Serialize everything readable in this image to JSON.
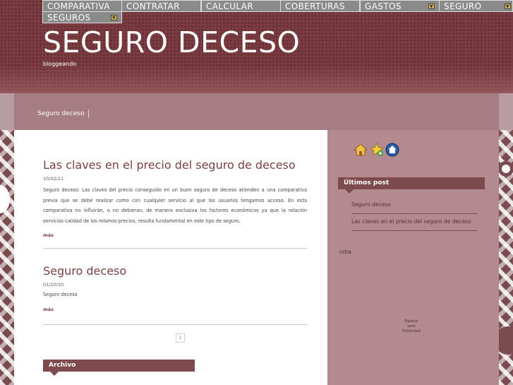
{
  "nav": {
    "items": [
      {
        "label": "COMPARATIVA",
        "dropdown": false
      },
      {
        "label": "CONTRATAR",
        "dropdown": false
      },
      {
        "label": "CALCULAR",
        "dropdown": false
      },
      {
        "label": "COBERTURAS",
        "dropdown": false
      },
      {
        "label": "GASTOS",
        "dropdown": true
      },
      {
        "label": "SEGURO",
        "dropdown": true
      },
      {
        "label": "SEGUROS",
        "dropdown": true
      }
    ]
  },
  "header": {
    "title": "SEGURO DECESO",
    "description": "bloggeando"
  },
  "tabs": {
    "active_label": "Seguro deceso"
  },
  "posts": [
    {
      "title": "Las claves en el precio del seguro de deceso",
      "date": "10/02/11",
      "body": "Seguro deceso: Las claves del precio conseguido en un buen seguro de deceso atienden a una comparativa previa que se debe realizar como con cualquier servicio al que los usuarios tengamos acceso. En esta comparativa no influirán, o no debieran, de manera exclusiva los factores económicos ya que la relación servicios-calidad de los mismos-precios, resulta fundamental en este tipo de seguro.",
      "more": "más"
    },
    {
      "title": "Seguro deceso",
      "date": "01/10/10",
      "body": "Seguro deceso",
      "more": "más"
    }
  ],
  "pager": {
    "current": "1"
  },
  "archive": {
    "header": "Archivo"
  },
  "sidebar": {
    "icons": [
      "home-icon",
      "favorite-star-icon",
      "homepage-globe-icon"
    ],
    "recent_header": "Últimos post",
    "recent_posts": [
      "Seguro deceso",
      "Las claves en el precio del seguro de deceso"
    ],
    "text": "roba",
    "ad_lines": [
      "Espacio",
      "para",
      "Publicidad"
    ]
  },
  "colors": {
    "header_bg": "#7a3c40",
    "title_text": "#7b3f43",
    "widget_header": "#7d4a4e",
    "sidebar_bg": "#b38a8f",
    "tabbar_bg": "#a67d82",
    "nav_bg": "#8a8a8a"
  }
}
